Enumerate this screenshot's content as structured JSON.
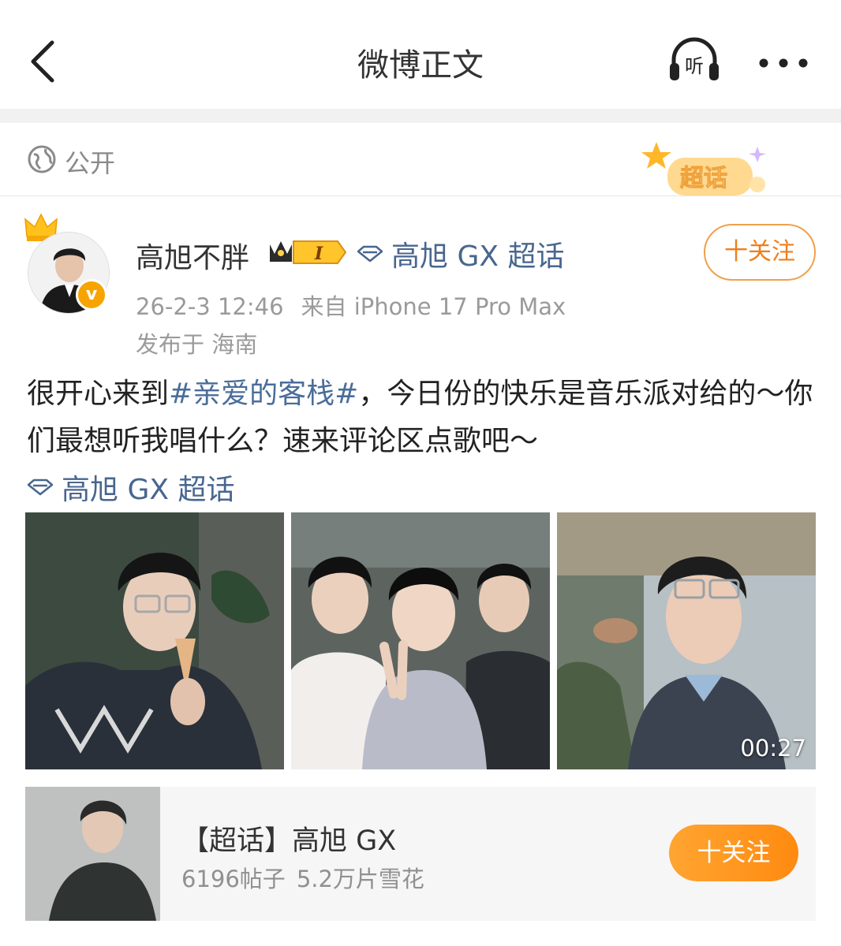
{
  "navbar": {
    "title": "微博正文",
    "listen_label": "听"
  },
  "visibility": {
    "label": "公开",
    "sticker_label": "超话"
  },
  "post": {
    "author": {
      "name": "高旭不胖",
      "level": "I",
      "verified_mark": "v"
    },
    "topic_tag_inline": "高旭 GX 超话",
    "follow_label": "十关注",
    "timestamp": "26-2-3 12:46",
    "source": "来自 iPhone 17 Pro Max",
    "location": "发布于 海南",
    "text": {
      "part1": "很开心来到",
      "hashtag": "#亲爱的客栈#",
      "part2": "，今日份的快乐是音乐派对给的～你们最想听我唱什么？速来评论区点歌吧～"
    },
    "topic_tag": "高旭 GX 超话",
    "media": [
      {
        "kind": "photo"
      },
      {
        "kind": "photo"
      },
      {
        "kind": "video",
        "duration": "00:27"
      }
    ]
  },
  "supertopic_card": {
    "title": "【超话】高旭 GX",
    "posts": "6196帖子",
    "snowflakes": "5.2万片雪花",
    "follow_label": "十关注"
  },
  "colors": {
    "link": "#48668f",
    "hashtag": "#4a6d9a",
    "accent_orange": "#ff8a10",
    "follow_outline": "#f0a04b"
  }
}
